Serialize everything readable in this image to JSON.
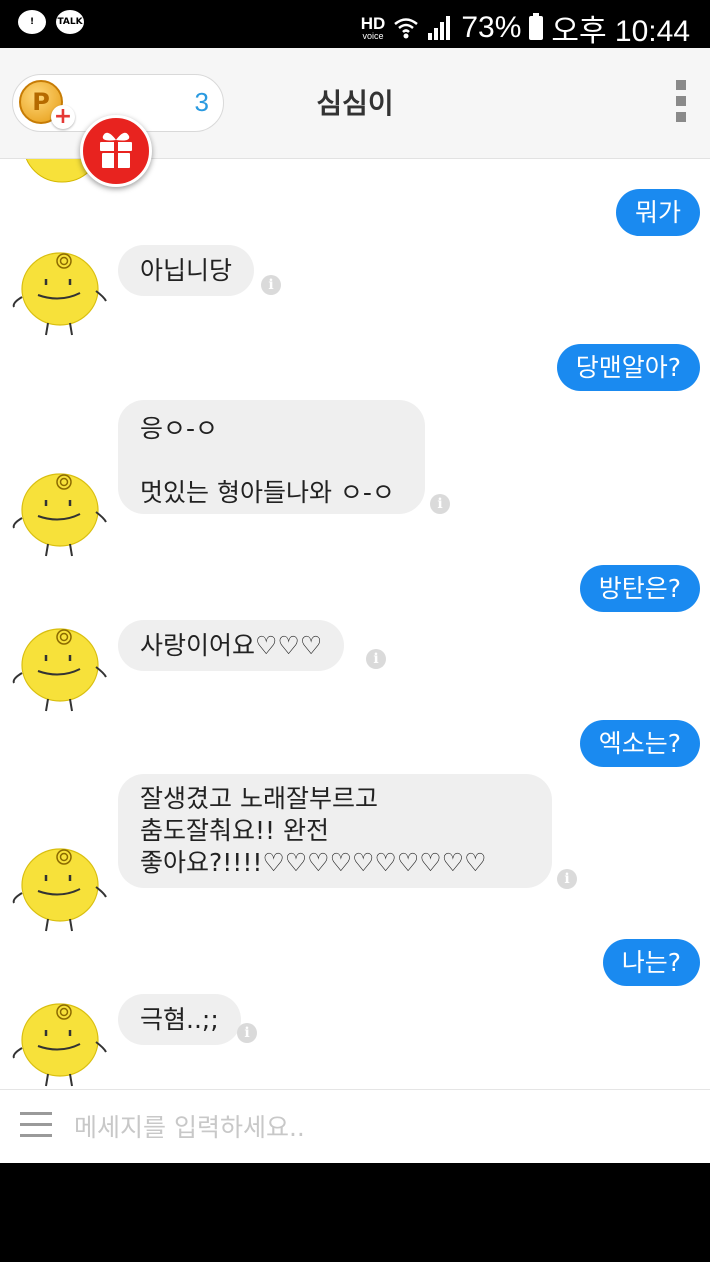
{
  "status_bar": {
    "notif_icons": [
      "message-alert-icon",
      "kakaotalk-icon"
    ],
    "kakao_label": "TALK",
    "hd_label": "HD",
    "hd_sub": "voice",
    "battery": "73%",
    "time": "오후 10:44"
  },
  "header": {
    "coin_symbol": "P",
    "coin_plus": "+",
    "coin_count": "3",
    "title": "심심이"
  },
  "messages": [
    {
      "from": "user",
      "text": "뭐가"
    },
    {
      "from": "bot",
      "text": "아닙니당"
    },
    {
      "from": "user",
      "text": "당맨알아?"
    },
    {
      "from": "bot",
      "text": "응ㅇ-ㅇ\n\n멋있는 형아들나와 ㅇ-ㅇ"
    },
    {
      "from": "user",
      "text": "방탄은?"
    },
    {
      "from": "bot",
      "text": "사랑이어요♡♡♡"
    },
    {
      "from": "user",
      "text": "엑소는?"
    },
    {
      "from": "bot",
      "text": "잘생겼고 노래잘부르고\n춤도잘춰요!! 완전\n좋아요?!!!!♡♡♡♡♡♡♡♡♡♡"
    },
    {
      "from": "user",
      "text": "나는?"
    },
    {
      "from": "bot",
      "text": "극혐..;;"
    }
  ],
  "info_glyph": "i",
  "input": {
    "placeholder": "메세지를 입력하세요.."
  },
  "colors": {
    "accent": "#1a8af0",
    "bot_bubble": "#efefef",
    "avatar": "#f7e13a",
    "gift": "#e8231f"
  }
}
